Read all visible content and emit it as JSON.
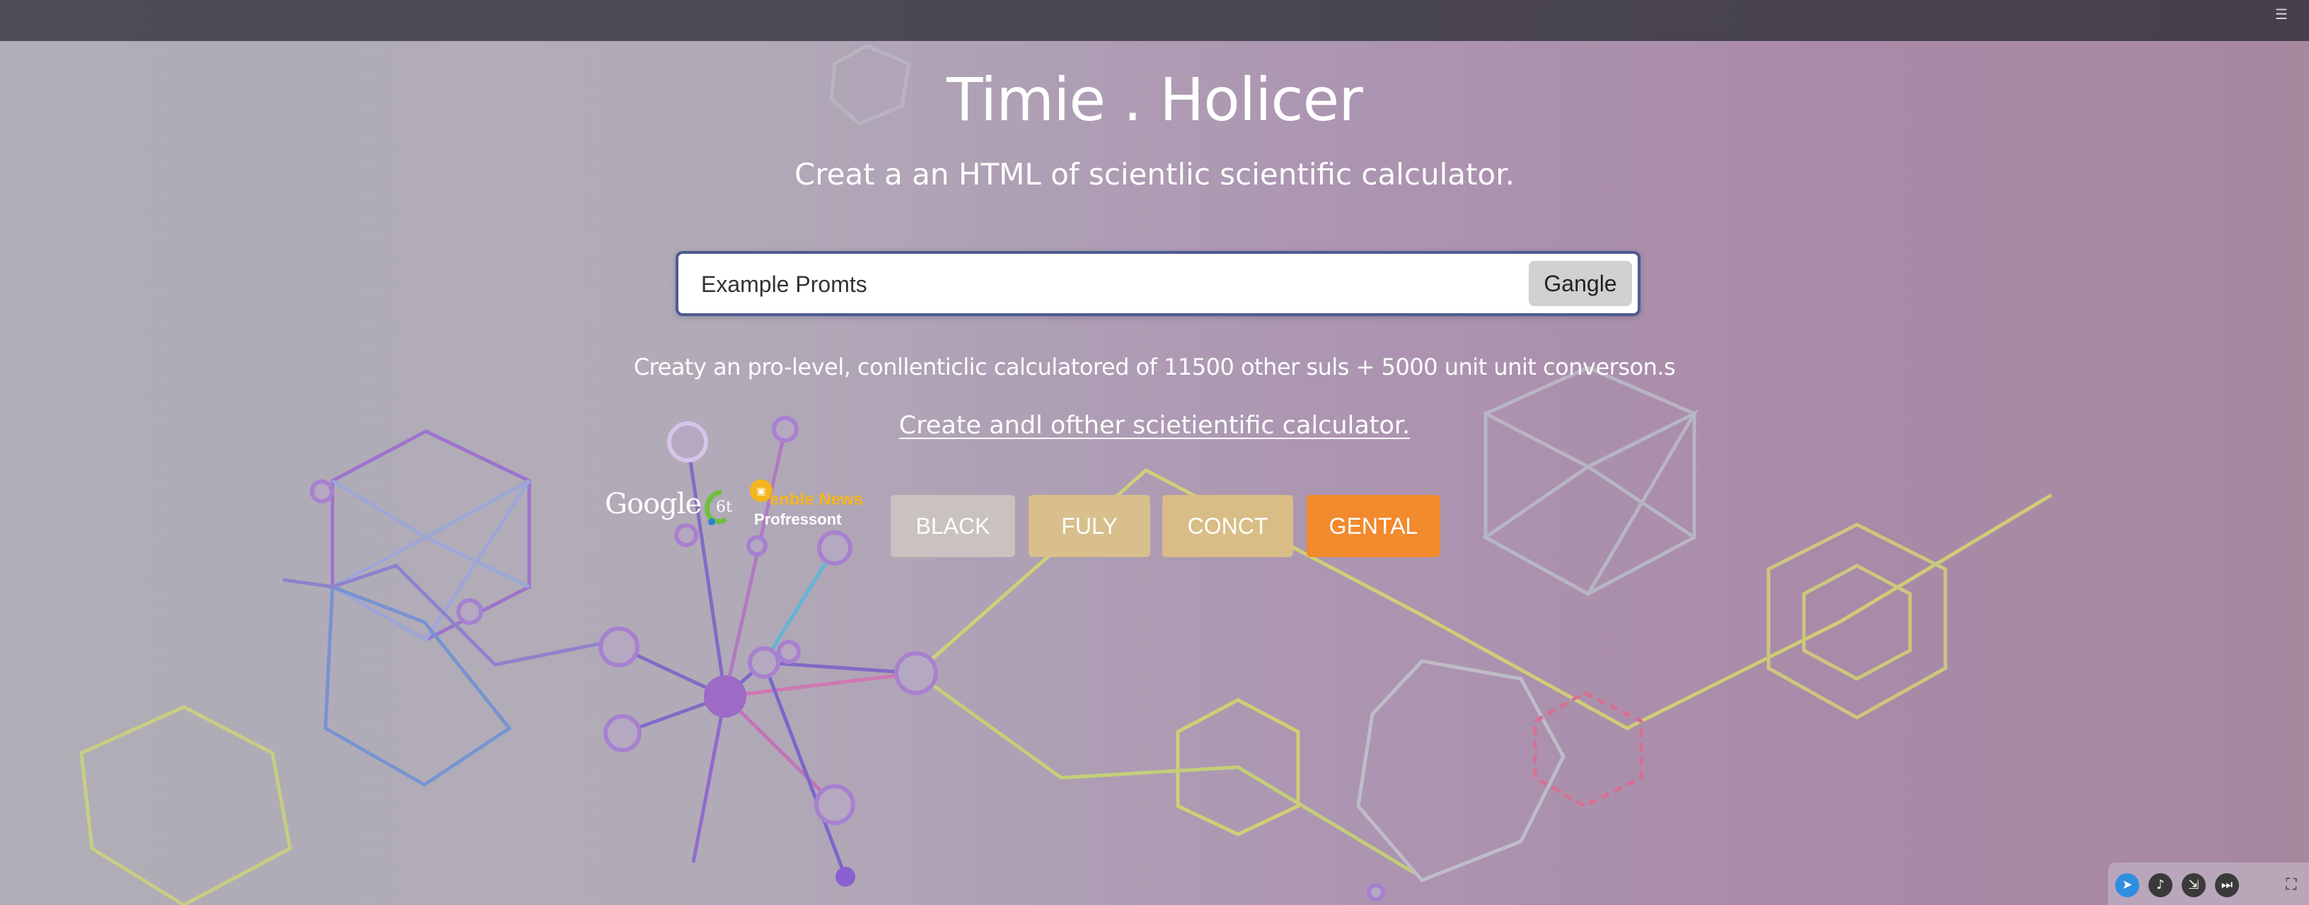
{
  "topbar": {
    "menu_icon": "hamburger-menu-icon"
  },
  "header": {
    "title": "Timie . Holicer",
    "subtitle": "Creat a an HTML of scientlic scientific calculator."
  },
  "search": {
    "placeholder": "Example Promts",
    "button_label": "Gangle"
  },
  "description": "Creaty an pro-level, conllenticlic calculatored of 11500 other suls + 5000 unit unit converson.s",
  "link_text": "Create andl ofther scietientific calculator.",
  "logos": {
    "google": "Google",
    "google_suffix": "6th",
    "news_badge_icon": "news-badge-icon",
    "news_label": "enble News",
    "news_sub": "Profressont"
  },
  "chips": [
    {
      "label": "BLACK",
      "color": "#c9c2c0"
    },
    {
      "label": "FULY",
      "color": "#d8bf8c"
    },
    {
      "label": "CONCT",
      "color": "#d9bd86"
    },
    {
      "label": "GENTAL",
      "color": "#f28a2e"
    }
  ],
  "dock": {
    "icons": [
      "compass-icon",
      "music-note-icon",
      "download-icon",
      "skip-icon",
      "apps-grid-icon"
    ]
  },
  "colors": {
    "topbar": "#4a4553",
    "search_border": "#4e5a8f",
    "accent_orange": "#f28a2e",
    "news_yellow": "#f5b51f"
  }
}
